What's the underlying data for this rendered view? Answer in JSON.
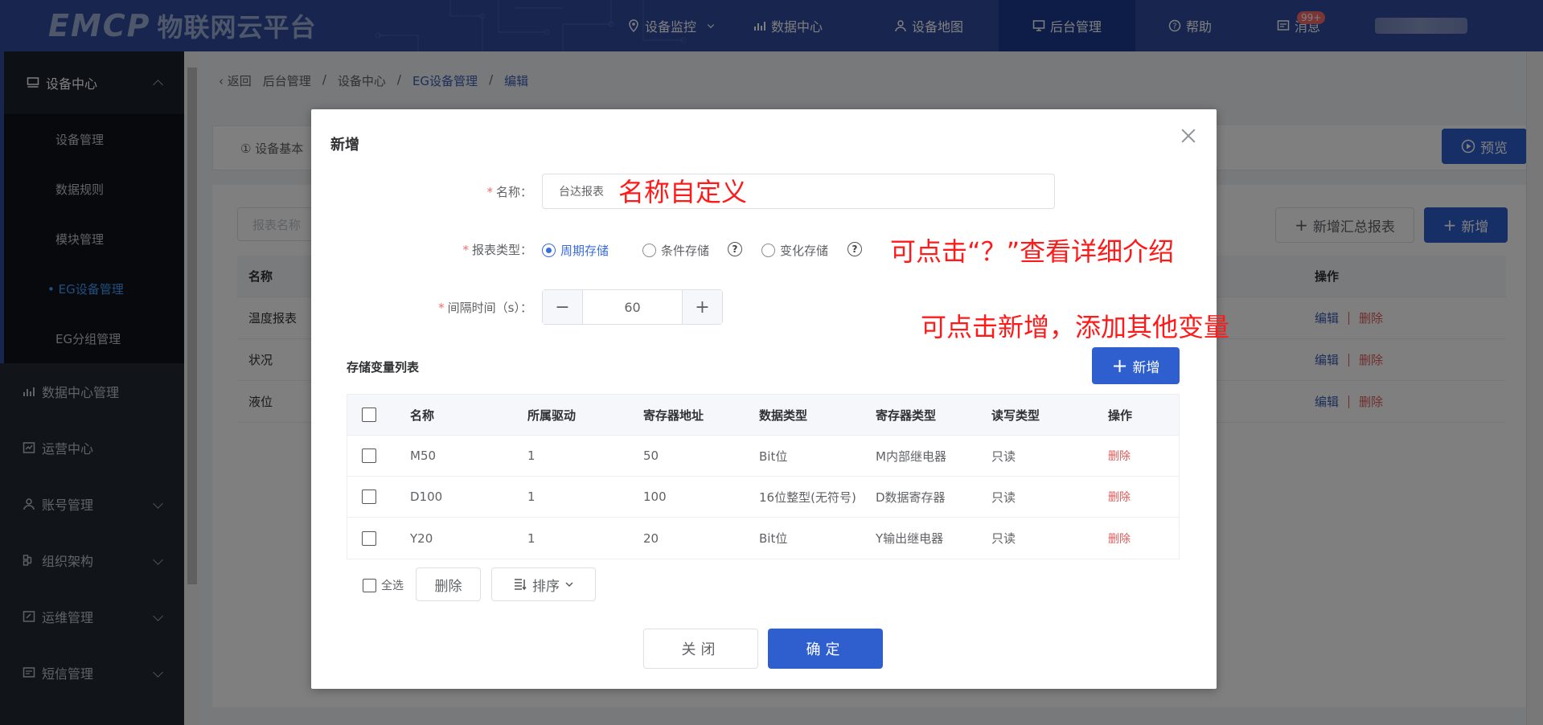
{
  "header": {
    "logo_text": "EMCP",
    "logo_sub": "物联网云平台",
    "nav": [
      {
        "label": "设备监控",
        "icon": "location-pin-icon"
      },
      {
        "label": "数据中心",
        "icon": "bar-chart-icon"
      },
      {
        "label": "设备地图",
        "icon": "map-user-icon"
      },
      {
        "label": "后台管理",
        "icon": "monitor-icon"
      },
      {
        "label": "帮助",
        "icon": "help-icon"
      },
      {
        "label": "消息",
        "icon": "message-icon"
      }
    ],
    "message_badge": "99+"
  },
  "sidebar": {
    "group": "设备中心",
    "sub_items": [
      "设备管理",
      "数据规则",
      "模块管理",
      "EG设备管理",
      "EG分组管理"
    ],
    "active_sub": "• EG设备管理",
    "items": [
      "数据中心管理",
      "运营中心",
      "账号管理",
      "组织架构",
      "运维管理",
      "短信管理"
    ]
  },
  "breadcrumb": {
    "back": "返回",
    "parts": [
      "后台管理",
      "/",
      "设备中心",
      "/",
      "EG设备管理",
      "/",
      "编辑"
    ]
  },
  "background": {
    "tab_label": "① 设备基本",
    "preview_button": "预览",
    "search_placeholder": "报表名称",
    "add_summary_button": "新增汇总报表",
    "add_button": "新增",
    "table_header_name": "名称",
    "table_header_ops": "操作",
    "rows": [
      "温度报表",
      "状况",
      "液位"
    ],
    "edit": "编辑",
    "delete": "删除"
  },
  "dialog": {
    "title": "新增",
    "name_label": "名称：",
    "name_value": "台达报表",
    "report_type_label": "报表类型：",
    "report_types": [
      "周期存储",
      "条件存储",
      "变化存储"
    ],
    "interval_label": "间隔时间（s）：",
    "interval_value": "60",
    "section_title": "存储变量列表",
    "add_button": "新增",
    "columns": [
      "名称",
      "所属驱动",
      "寄存器地址",
      "数据类型",
      "寄存器类型",
      "读写类型",
      "操作"
    ],
    "rows": [
      {
        "name": "M50",
        "driver": "1",
        "address": "50",
        "data_type": "Bit位",
        "reg_type": "M内部继电器",
        "rw": "只读",
        "op": "删除"
      },
      {
        "name": "D100",
        "driver": "1",
        "address": "100",
        "data_type": "16位整型(无符号)",
        "reg_type": "D数据寄存器",
        "rw": "只读",
        "op": "删除"
      },
      {
        "name": "Y20",
        "driver": "1",
        "address": "20",
        "data_type": "Bit位",
        "reg_type": "Y输出继电器",
        "rw": "只读",
        "op": "删除"
      }
    ],
    "select_all": "全选",
    "delete_button": "删除",
    "sort_button": "排序",
    "close_button": "关闭",
    "confirm_button": "确定"
  },
  "annotations": {
    "name_hint": "名称自定义",
    "help_hint": "可点击“？”查看详细介绍",
    "add_hint": "可点击新增，添加其他变量"
  },
  "colors": {
    "header_bg": "#2f4b9e",
    "primary": "#2f5fcf",
    "sidebar_bg": "#232a33",
    "danger": "#e05a5a",
    "annotation": "#ff1a1a"
  }
}
